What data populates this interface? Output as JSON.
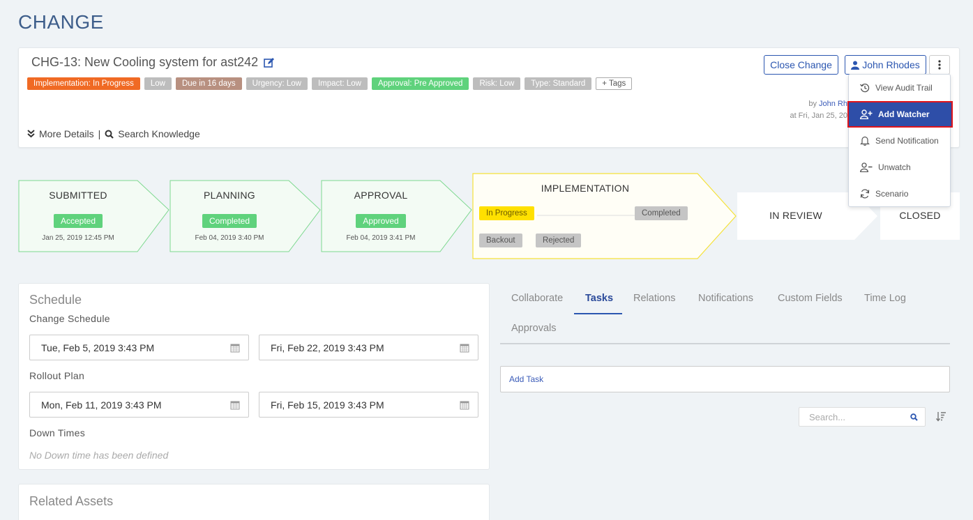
{
  "page": {
    "title": "CHANGE"
  },
  "ticket": {
    "title": "CHG-13: New Cooling system for ast242",
    "tags": [
      {
        "label": "Implementation: In Progress",
        "color": "#f06a24"
      },
      {
        "label": "Low",
        "color": "#bdbdbd"
      },
      {
        "label": "Due in 16 days",
        "color": "#b89080"
      },
      {
        "label": "Urgency: Low",
        "color": "#bdbdbd"
      },
      {
        "label": "Impact: Low",
        "color": "#bdbdbd"
      },
      {
        "label": "Approval: Pre Approved",
        "color": "#5fd27c"
      },
      {
        "label": "Risk: Low",
        "color": "#bdbdbd"
      },
      {
        "label": "Type: Standard",
        "color": "#bdbdbd"
      }
    ],
    "add_tags_label": "+ Tags",
    "more_details": "More Details",
    "separator": "|",
    "search_knowledge": "Search Knowledge",
    "byline_prefix": "by",
    "byline_user": "John Rh",
    "byline_date": "at Fri, Jan 25, 20"
  },
  "actions": {
    "close_change": "Close Change",
    "user": "John Rhodes"
  },
  "menu": {
    "items": [
      {
        "label": "View Audit Trail",
        "icon": "history-icon"
      },
      {
        "label": "Add Watcher",
        "icon": "add-user-icon"
      },
      {
        "label": "Send Notification",
        "icon": "bell-icon"
      },
      {
        "label": "Unwatch",
        "icon": "remove-user-icon"
      },
      {
        "label": "Scenario",
        "icon": "refresh-icon"
      }
    ],
    "active_index": 1
  },
  "workflow": {
    "submitted": {
      "label": "SUBMITTED",
      "status": "Accepted",
      "date": "Jan 25, 2019 12:45 PM"
    },
    "planning": {
      "label": "PLANNING",
      "status": "Completed",
      "date": "Feb 04, 2019 3:40 PM"
    },
    "approval": {
      "label": "APPROVAL",
      "status": "Approved",
      "date": "Feb 04, 2019 3:41 PM"
    },
    "implementation": {
      "label": "IMPLEMENTATION",
      "in_progress": "In Progress",
      "completed": "Completed",
      "backout": "Backout",
      "rejected": "Rejected"
    },
    "in_review": {
      "label": "IN REVIEW"
    },
    "closed": {
      "label": "CLOSED"
    }
  },
  "schedule": {
    "title": "Schedule",
    "change_schedule_label": "Change Schedule",
    "change_start": "Tue, Feb 5, 2019 3:43 PM",
    "change_end": "Fri, Feb 22, 2019 3:43 PM",
    "rollout_label": "Rollout Plan",
    "rollout_start": "Mon, Feb 11, 2019 3:43 PM",
    "rollout_end": "Fri, Feb 15, 2019 3:43 PM",
    "down_times_label": "Down Times",
    "down_times_empty": "No Down time has been defined"
  },
  "related_assets": {
    "title": "Related Assets"
  },
  "tabs": {
    "items": [
      "Collaborate",
      "Tasks",
      "Relations",
      "Notifications",
      "Custom Fields",
      "Time Log",
      "Approvals"
    ],
    "active": "Tasks"
  },
  "tasks": {
    "add_task": "Add Task",
    "search_placeholder": "Search..."
  }
}
